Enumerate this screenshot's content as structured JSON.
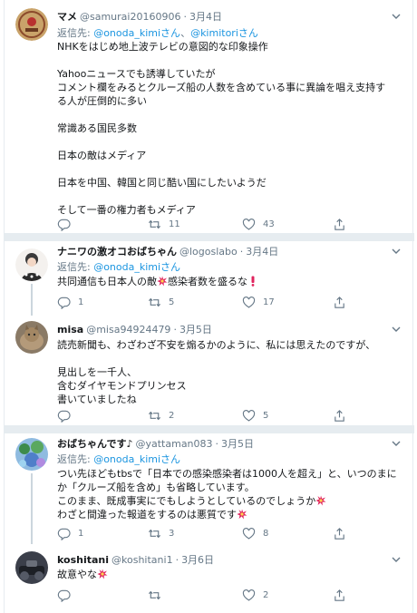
{
  "tweets": [
    {
      "name": "マメ",
      "handle": "@samurai20160906",
      "date": "3月4日",
      "reply_prefix": "返信先: ",
      "reply_to": [
        "@onoda_kimiさん",
        "@kimitoriさん"
      ],
      "reply_joiner": "、",
      "lines": [
        "NHKをはじめ地上波テレビの意図的な印象操作",
        "",
        "Yahooニュースでも誘導していたが",
        "コメント欄をみるとクルーズ船の人数を含めている事に異論を唱え支持す",
        "る人が圧倒的に多い",
        "",
        "常識ある国民多数",
        "",
        "日本の敵はメディア",
        "",
        "日本を中国、韓国と同じ酷い国にしたいようだ",
        "",
        "そして一番の権力者もメディア"
      ],
      "reply_count": "",
      "retweet_count": "11",
      "like_count": "43"
    },
    {
      "name": "ナニワの激オコおばちゃん",
      "handle": "@logoslabo",
      "date": "3月4日",
      "reply_prefix": "返信先: ",
      "reply_to": [
        "@onoda_kimiさん"
      ],
      "reply_joiner": "",
      "lines": [
        "共同通信も日本人の敵",
        "感染者数を盛るな"
      ],
      "reply_count": "1",
      "retweet_count": "5",
      "like_count": "17"
    },
    {
      "name": "misa",
      "handle": "@misa94924479",
      "date": "3月5日",
      "lines": [
        "読売新聞も、わざわざ不安を煽るかのように、私には思えたのですが、",
        "",
        "見出しを一千人、",
        "含むダイヤモンドプリンセス",
        "書いていましたね"
      ],
      "reply_count": "",
      "retweet_count": "2",
      "like_count": "5"
    },
    {
      "name": "おばちゃんです♪",
      "handle": "@yattaman083",
      "date": "3月5日",
      "reply_prefix": "返信先: ",
      "reply_to": [
        "@onoda_kimiさん"
      ],
      "reply_joiner": "",
      "lines": [
        "つい先ほどもtbsで「日本での感染感染者は1000人を超え」と、いつのまに",
        "か「クルーズ船を含め」も省略しています。",
        "このまま、既成事実にでもしようとしているのでしょうか",
        "わざと間違った報道をするのは悪質です"
      ],
      "reply_count": "1",
      "retweet_count": "3",
      "like_count": "8"
    },
    {
      "name": "koshitani",
      "handle": "@koshitani1",
      "date": "3月6日",
      "lines": [
        "故意やな"
      ],
      "reply_count": "",
      "retweet_count": "",
      "like_count": "2"
    }
  ],
  "colors": {
    "text": "#14171a",
    "muted": "#657786",
    "link": "#1b95e0",
    "divider": "#e6ecf0",
    "thread_line": "#ccd6dd",
    "anger_symbol": "#e0245e"
  },
  "icons": [
    "reply-icon",
    "retweet-icon",
    "like-icon",
    "share-icon",
    "caret-down-icon",
    "anger-symbol-icon",
    "exclamation-icon"
  ]
}
